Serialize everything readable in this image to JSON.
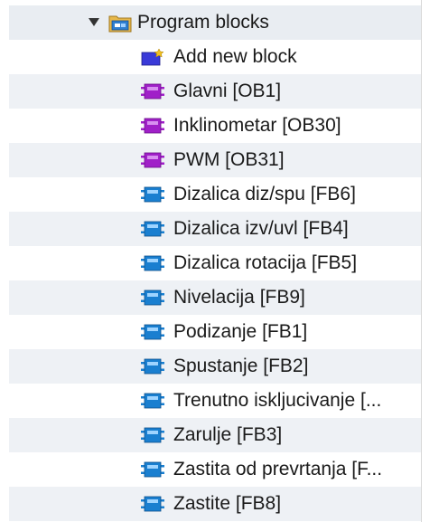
{
  "tree": {
    "root": {
      "label": "Program blocks",
      "icon": "folder-icon",
      "expanded": true
    },
    "items": [
      {
        "label": "Add new block",
        "icon": "add-block-icon"
      },
      {
        "label": "Glavni [OB1]",
        "icon": "organization-block-icon"
      },
      {
        "label": "Inklinometar [OB30]",
        "icon": "organization-block-icon"
      },
      {
        "label": "PWM [OB31]",
        "icon": "organization-block-icon"
      },
      {
        "label": "Dizalica diz/spu [FB6]",
        "icon": "function-block-icon"
      },
      {
        "label": "Dizalica izv/uvl [FB4]",
        "icon": "function-block-icon"
      },
      {
        "label": "Dizalica rotacija [FB5]",
        "icon": "function-block-icon"
      },
      {
        "label": "Nivelacija [FB9]",
        "icon": "function-block-icon"
      },
      {
        "label": "Podizanje [FB1]",
        "icon": "function-block-icon"
      },
      {
        "label": "Spustanje [FB2]",
        "icon": "function-block-icon"
      },
      {
        "label": "Trenutno iskljucivanje [...",
        "icon": "function-block-icon"
      },
      {
        "label": "Zarulje [FB3]",
        "icon": "function-block-icon"
      },
      {
        "label": "Zastita od prevrtanja [F...",
        "icon": "function-block-icon"
      },
      {
        "label": "Zastite [FB8]",
        "icon": "function-block-icon"
      }
    ]
  },
  "colors": {
    "organization_block": "#a020c8",
    "function_block": "#1a7fd0",
    "add_block": "#3a3ad8",
    "add_block_star": "#f0c020",
    "folder": "#e8b84a",
    "row_alt": "#eef1f5"
  }
}
